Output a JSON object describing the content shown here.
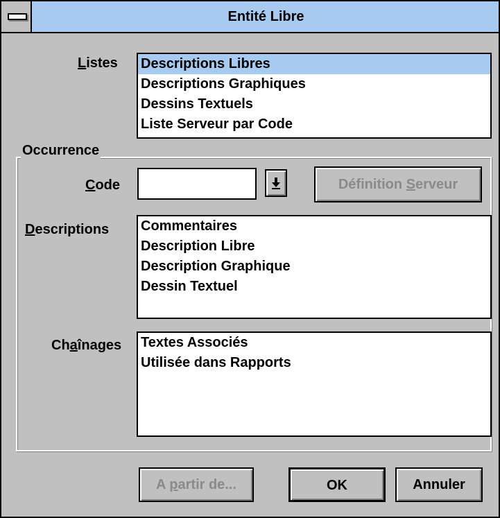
{
  "window": {
    "title": "Entité Libre"
  },
  "listes": {
    "label_u": "L",
    "label_rest": "istes",
    "items": [
      "Descriptions Libres",
      "Descriptions Graphiques",
      "Dessins Textuels",
      "Liste Serveur par Code"
    ]
  },
  "occurrence": {
    "group_title": "Occurrence",
    "code": {
      "label_u": "C",
      "label_rest": "ode",
      "value": ""
    },
    "def_button": {
      "label_pre": "Définition ",
      "label_u": "S",
      "label_post": "erveur"
    },
    "descriptions": {
      "label_u": "D",
      "label_rest": "escriptions",
      "items": [
        "Commentaires",
        "Description Libre",
        "Description Graphique",
        "Dessin Textuel"
      ]
    },
    "chainages": {
      "label_pre": "Ch",
      "label_u": "a",
      "label_post": "înages",
      "items": [
        "Textes Associés",
        "Utilisée dans Rapports"
      ]
    }
  },
  "buttons": {
    "apartir": {
      "label_pre": "A ",
      "label_u": "p",
      "label_post": "artir de..."
    },
    "ok": "OK",
    "cancel": "Annuler"
  },
  "icons": {
    "system_menu": "system-menu-icon",
    "dropdown": "arrow-down-icon"
  }
}
